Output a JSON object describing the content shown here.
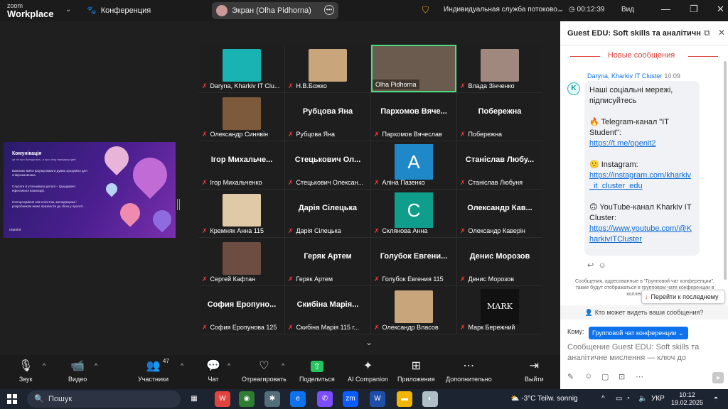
{
  "topbar": {
    "logo_line1": "zoom",
    "logo_line2": "Workplace",
    "conference_label": "Конференция",
    "screen_pill": "Экран (Olha Pidhorna)",
    "service_label": "Индивидуальная служба потоково...",
    "timer": "00:12:39",
    "view_label": "Вид"
  },
  "shared_screen": {
    "title": "Комунікація",
    "subtitle": "це не про балакучість, а про чітку передачу ідей",
    "bullets": [
      "Важливо вміти формулювати думки зрозуміло для співрозмовника.",
      "Слухати й уточнювати деталі – фундамент ефективної взаємодії.",
      "Непорозуміння між клієнтом, менеджером і розробником може призвести до збою у проєкті."
    ],
    "brand": "onpoint"
  },
  "participants": [
    {
      "name": "Daryna, Kharkiv IT Clu...",
      "big": "",
      "kind": "logo"
    },
    {
      "name": "Н.В.Божко",
      "big": "",
      "kind": "photo"
    },
    {
      "name": "Olha Pidhorna",
      "big": "",
      "kind": "active"
    },
    {
      "name": "Влада Зінченко",
      "big": "",
      "kind": "photo"
    },
    {
      "name": "Олександр Синявін",
      "big": "",
      "kind": "photo"
    },
    {
      "name": "Рубцова Яна",
      "big": "Рубцова Яна",
      "kind": "text"
    },
    {
      "name": "Пархомов Вячеслав",
      "big": "Пархомов Вяче...",
      "kind": "text"
    },
    {
      "name": "Побережна",
      "big": "Побережна",
      "kind": "text"
    },
    {
      "name": "Ігор Михальченко",
      "big": "Ігор Михальче...",
      "kind": "text"
    },
    {
      "name": "Стецькович Олексан...",
      "big": "Стецькович Ол...",
      "kind": "text"
    },
    {
      "name": "Аліна Пазенко",
      "big": "",
      "kind": "letter",
      "letter": "A",
      "color": "#1e88c8"
    },
    {
      "name": "Станіслав Любуня",
      "big": "Станіслав Любу...",
      "kind": "text"
    },
    {
      "name": "Кремняк Анна 115",
      "big": "",
      "kind": "photo"
    },
    {
      "name": "Дарія Сілецька",
      "big": "Дарія Сілецька",
      "kind": "text"
    },
    {
      "name": "Склянова Анна",
      "big": "",
      "kind": "letter",
      "letter": "C",
      "color": "#0f9d8c"
    },
    {
      "name": "Олександр Каверін",
      "big": "Олександр Кав...",
      "kind": "text"
    },
    {
      "name": "Сергей Кафтан",
      "big": "",
      "kind": "photo"
    },
    {
      "name": "Геряк Артем",
      "big": "Геряк Артем",
      "kind": "text"
    },
    {
      "name": "Голубок Евгения 115",
      "big": "Голубок Евгени...",
      "kind": "text"
    },
    {
      "name": "Денис Морозов",
      "big": "Денис Морозов",
      "kind": "text"
    },
    {
      "name": "София Еропунова 125",
      "big": "София Еропуно...",
      "kind": "text"
    },
    {
      "name": "Скибіна Марія 115 г...",
      "big": "Скибіна Марія...",
      "kind": "text"
    },
    {
      "name": "Олександр Власов",
      "big": "",
      "kind": "photo"
    },
    {
      "name": "Марк Бережний",
      "big": "",
      "kind": "mark",
      "letter": "MARK"
    }
  ],
  "toolbar": {
    "audio": "Звук",
    "video": "Видео",
    "participants": "Участники",
    "participants_count": "47",
    "chat": "Чат",
    "react": "Отреагировать",
    "share": "Поделиться",
    "ai": "AI Companion",
    "apps": "Приложения",
    "more": "Дополнительно",
    "leave": "Выйти"
  },
  "chat": {
    "header": "Guest EDU: Soft skills та аналітичне ...",
    "new_messages": "Новые сообщения",
    "sender": "Daryna, Kharkiv IT Cluster",
    "time": "10:09",
    "lines": {
      "l1": "Наші соціальні мережі, підписуйтесь",
      "l2": "🔥 Telegram-канал \"IT Student\":",
      "l3": "https://t.me/openit2",
      "l4": "🙂 Instagram:",
      "l5": "https://instagram.com/kharkiv_it_cluster_edu",
      "l6": "🙃 YouTube-канал Kharkiv IT Cluster:",
      "l7": "https://www.youtube.com/@KharkivITCluster"
    },
    "notice": "Сообщения, адресованные в \"Групповой чат конференции\", также будут отображаться в групповом чате конференции в коллективном...",
    "jump_label": "Перейти к последнему",
    "who_can_see": "Кто может видеть ваши сообщения?",
    "to_label": "Кому:",
    "to_value": "Групповой чат конференции",
    "compose_placeholder": "Сообщение Guest EDU: Soft skills та аналітичне мислення — ключ до"
  },
  "taskbar": {
    "search_label": "Пошук",
    "weather": "-3°C  Teilw. sonnig",
    "lang": "УКР",
    "time": "10:12",
    "date": "19.02.2025"
  },
  "colors": {
    "mic_muted": "#ff3b30",
    "accent": "#0e72ed",
    "active_border": "#4ade80",
    "new_msg": "#e0443e"
  }
}
